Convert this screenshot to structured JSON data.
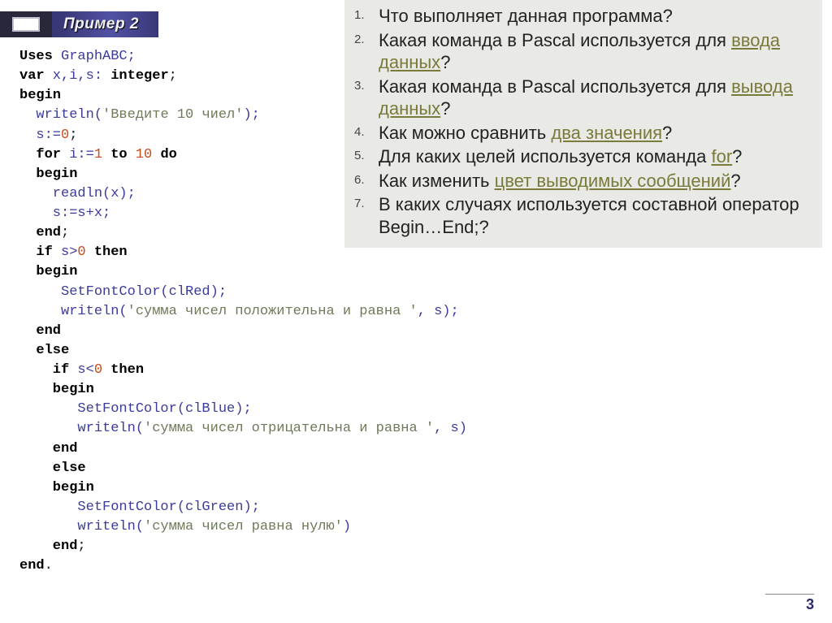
{
  "title": "Пример 2",
  "page_number": "3",
  "code": {
    "l1a": "Uses",
    "l1b": " GraphABC;",
    "l2a": "var",
    "l2b": " x,i,s: ",
    "l2c": "integer",
    "l2d": ";",
    "l3": "begin",
    "l4a": "  writeln(",
    "l4b": "'Введите 10 чиел'",
    "l4c": ");",
    "l5a": "  s:=",
    "l5b": "0",
    "l5c": ";",
    "l6a": "  for",
    "l6b": " i:=",
    "l6c": "1",
    "l6d": " to ",
    "l6e": "10",
    "l6f": " do",
    "l7": "  begin",
    "l8": "    readln(x);",
    "l9": "    s:=s+x;",
    "l10a": "  end",
    "l10b": ";",
    "l11a": "  if",
    "l11b": " s>",
    "l11c": "0",
    "l11d": " then",
    "l12": "  begin",
    "l13": "     SetFontColor(clRed);",
    "l14a": "     writeln(",
    "l14b": "'сумма чисел положительна и равна '",
    "l14c": ", s);",
    "l15": "  end",
    "l16": "  else",
    "l17a": "    if",
    "l17b": " s<",
    "l17c": "0",
    "l17d": " then",
    "l18": "    begin",
    "l19": "       SetFontColor(clBlue);",
    "l20a": "       writeln(",
    "l20b": "'сумма чисел отрицательна и равна '",
    "l20c": ", s)",
    "l21": "    end",
    "l22": "    else",
    "l23": "    begin",
    "l24": "       SetFontColor(clGreen);",
    "l25a": "       writeln(",
    "l25b": "'сумма чисел равна нулю'",
    "l25c": ")",
    "l26a": "    end",
    "l26b": ";",
    "l27a": "end",
    "l27b": "."
  },
  "questions": [
    {
      "pre": "Что выполняет данная программа?",
      "link": "",
      "post": ""
    },
    {
      "pre": "Какая команда в Pascal используется для ",
      "link": "ввода данных",
      "post": "?"
    },
    {
      "pre": "Какая команда в Pascal используется для ",
      "link": "вывода данных",
      "post": "?"
    },
    {
      "pre": "Как можно сравнить ",
      "link": "два значения",
      "post": "?"
    },
    {
      "pre": "Для каких целей используется команда ",
      "link": "for",
      "post": "?"
    },
    {
      "pre": "Как изменить ",
      "link": "цвет выводимых сообщений",
      "post": "?"
    },
    {
      "pre": "В каких случаях используется составной оператор Begin…End;?",
      "link": "",
      "post": ""
    }
  ]
}
